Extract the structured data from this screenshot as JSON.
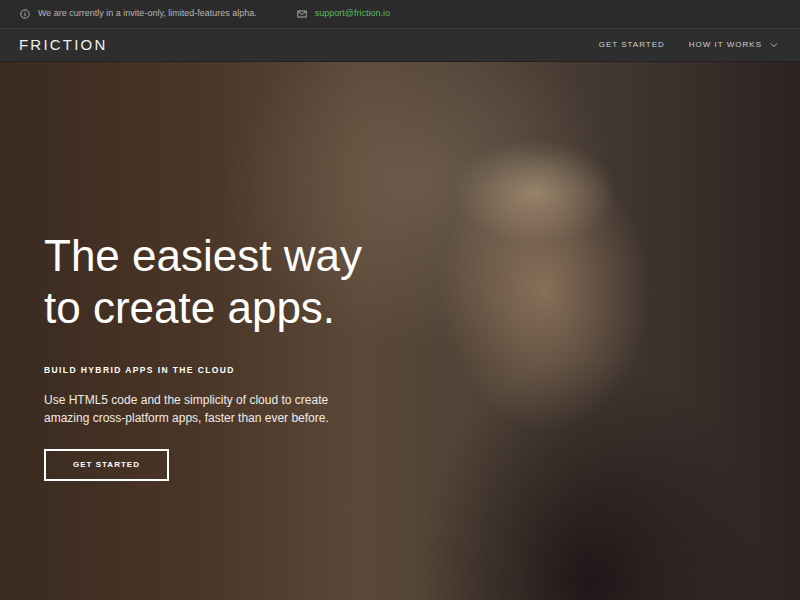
{
  "notice": {
    "text": "We are currently in a invite-only, limited-features alpha."
  },
  "contact": {
    "email": "support@friction.io"
  },
  "navbar": {
    "brand": "FRICTION",
    "items": [
      {
        "label": "GET STARTED",
        "kind": "link"
      },
      {
        "label": "HOW IT WORKS",
        "kind": "dropdown"
      }
    ]
  },
  "hero": {
    "title": [
      "The easiest way",
      "to create apps."
    ],
    "kicker": "BUILD HYBRID APPS IN THE CLOUD",
    "text": "Use HTML5 code and the simplicity of cloud to create amazing cross-platform apps, faster than ever before.",
    "button": "GET STARTED"
  }
}
